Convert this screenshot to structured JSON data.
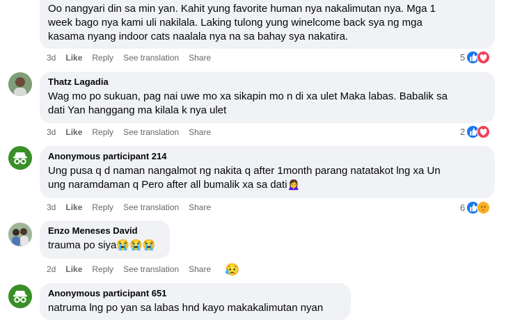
{
  "comments": [
    {
      "text_lines": [
        "Oo nangyari din sa min yan. Kahit yung favorite human nya nakalimutan nya. Mga 1",
        "week bago nya kami uli nakilala. Laking tulong yung winelcome back sya ng mga",
        "kasama nyang indoor cats naalala nya na sa bahay sya nakatira."
      ],
      "time": "3d",
      "like": "Like",
      "reply": "Reply",
      "see_translation": "See translation",
      "share": "Share",
      "reaction_count": "5",
      "reactions": [
        "like-icon",
        "heart-icon"
      ]
    },
    {
      "author": "Thatz Lagadia",
      "text_lines": [
        "Wag mo po sukuan, pag nai uwe mo xa sikapin mo n di xa ulet Maka labas. Babalik sa",
        "dati Yan hanggang ma kilala k nya ulet"
      ],
      "time": "3d",
      "like": "Like",
      "reply": "Reply",
      "see_translation": "See translation",
      "share": "Share",
      "reaction_count": "2",
      "reactions": [
        "like-icon",
        "heart-icon"
      ]
    },
    {
      "author": "Anonymous participant 214",
      "text_lines": [
        "Ung pusa q d naman nangalmot ng nakita q after 1month parang natatakot lng xa Un",
        "ung naramdaman q Pero after all bumalik xa sa dati"
      ],
      "emoji": "🙍‍♀️",
      "time": "3d",
      "like": "Like",
      "reply": "Reply",
      "see_translation": "See translation",
      "share": "Share",
      "reaction_count": "6",
      "reactions": [
        "like-icon",
        "care-icon"
      ]
    },
    {
      "author": "Enzo Meneses David",
      "text": "trauma po siya",
      "emoji": "😭😭😭",
      "time": "2d",
      "like": "Like",
      "reply": "Reply",
      "see_translation": "See translation",
      "share": "Share",
      "reaction_emoji": "😥"
    },
    {
      "author": "Anonymous participant 651",
      "text": "natruma lng po yan sa labas hnd kayo makakalimutan nyan"
    }
  ],
  "colors": {
    "bubble": "#f0f2f5",
    "like_blue": "#1877f2",
    "heart_red": "#f33e58",
    "meta_gray": "#65676b",
    "anon_green": "#3a8f28"
  }
}
